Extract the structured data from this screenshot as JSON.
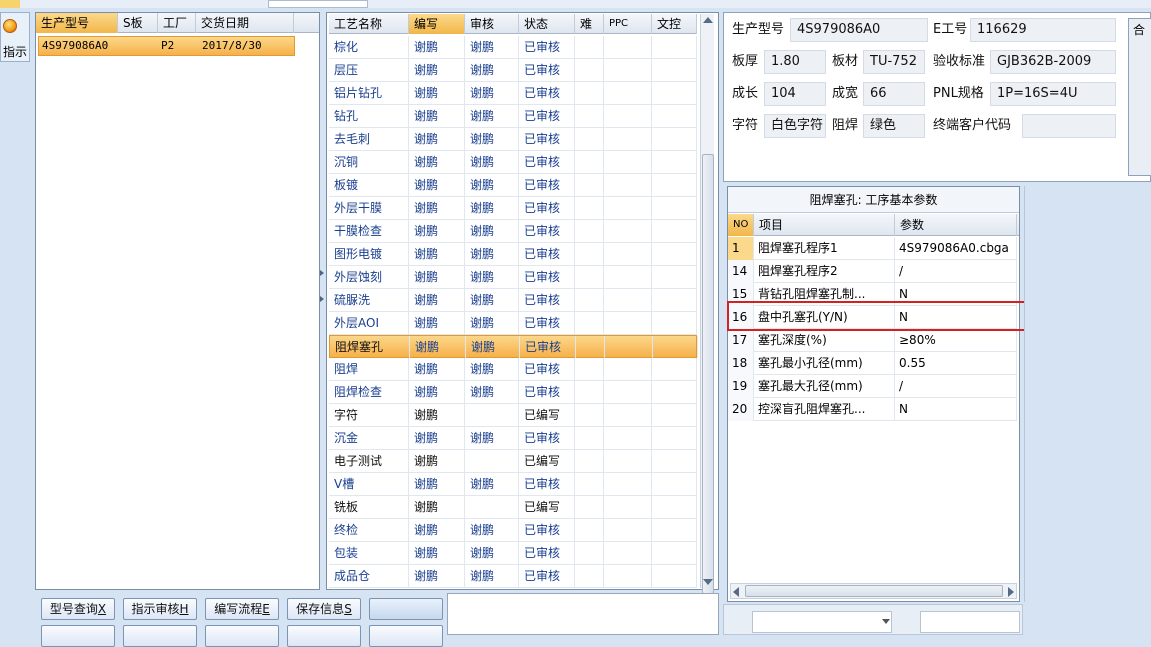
{
  "toolbar": {
    "active_tab": "",
    "guide_label": "指示"
  },
  "product_list": {
    "headers": [
      "生产型号",
      "S板",
      "工厂",
      "交货日期"
    ],
    "row": {
      "model": "4S979086A0",
      "s_board": "",
      "factory": "P2",
      "delivery_date": "2017/8/30"
    }
  },
  "process_grid": {
    "headers": [
      "工艺名称",
      "编写",
      "审核",
      "状态",
      "难",
      "PPC",
      "文控"
    ],
    "rows": [
      {
        "name": "棕化",
        "writer": "谢鹏",
        "reviewer": "谢鹏",
        "status": "已审核"
      },
      {
        "name": "层压",
        "writer": "谢鹏",
        "reviewer": "谢鹏",
        "status": "已审核"
      },
      {
        "name": "铝片钻孔",
        "writer": "谢鹏",
        "reviewer": "谢鹏",
        "status": "已审核"
      },
      {
        "name": "钻孔",
        "writer": "谢鹏",
        "reviewer": "谢鹏",
        "status": "已审核"
      },
      {
        "name": "去毛刺",
        "writer": "谢鹏",
        "reviewer": "谢鹏",
        "status": "已审核"
      },
      {
        "name": "沉铜",
        "writer": "谢鹏",
        "reviewer": "谢鹏",
        "status": "已审核"
      },
      {
        "name": "板镀",
        "writer": "谢鹏",
        "reviewer": "谢鹏",
        "status": "已审核"
      },
      {
        "name": "外层干膜",
        "writer": "谢鹏",
        "reviewer": "谢鹏",
        "status": "已审核"
      },
      {
        "name": "干膜检查",
        "writer": "谢鹏",
        "reviewer": "谢鹏",
        "status": "已审核"
      },
      {
        "name": "图形电镀",
        "writer": "谢鹏",
        "reviewer": "谢鹏",
        "status": "已审核"
      },
      {
        "name": "外层蚀刻",
        "writer": "谢鹏",
        "reviewer": "谢鹏",
        "status": "已审核"
      },
      {
        "name": "硫脲洗",
        "writer": "谢鹏",
        "reviewer": "谢鹏",
        "status": "已审核"
      },
      {
        "name": "外层AOI",
        "writer": "谢鹏",
        "reviewer": "谢鹏",
        "status": "已审核"
      },
      {
        "name": "阻焊塞孔",
        "writer": "谢鹏",
        "reviewer": "谢鹏",
        "status": "已审核"
      },
      {
        "name": "阻焊",
        "writer": "谢鹏",
        "reviewer": "谢鹏",
        "status": "已审核"
      },
      {
        "name": "阻焊检查",
        "writer": "谢鹏",
        "reviewer": "谢鹏",
        "status": "已审核"
      },
      {
        "name": "字符",
        "writer": "谢鹏",
        "reviewer": "",
        "status": "已编写"
      },
      {
        "name": "沉金",
        "writer": "谢鹏",
        "reviewer": "谢鹏",
        "status": "已审核"
      },
      {
        "name": "电子测试",
        "writer": "谢鹏",
        "reviewer": "",
        "status": "已编写"
      },
      {
        "name": "V槽",
        "writer": "谢鹏",
        "reviewer": "谢鹏",
        "status": "已审核"
      },
      {
        "name": "铣板",
        "writer": "谢鹏",
        "reviewer": "",
        "status": "已编写"
      },
      {
        "name": "终检",
        "writer": "谢鹏",
        "reviewer": "谢鹏",
        "status": "已审核"
      },
      {
        "name": "包装",
        "writer": "谢鹏",
        "reviewer": "谢鹏",
        "status": "已审核"
      },
      {
        "name": "成品仓",
        "writer": "谢鹏",
        "reviewer": "谢鹏",
        "status": "已审核"
      }
    ]
  },
  "buttons": [
    {
      "label": "型号查询",
      "key": "X"
    },
    {
      "label": "指示审核",
      "key": "H"
    },
    {
      "label": "编写流程",
      "key": "E"
    },
    {
      "label": "保存信息",
      "key": "S"
    },
    {
      "label": "",
      "key": ""
    }
  ],
  "info": {
    "model_label": "生产型号",
    "model_value": "4S979086A0",
    "e_label": "E工号",
    "e_value": "116629",
    "thickness_label": "板厚",
    "thickness_value": "1.80",
    "material_label": "板材",
    "material_value": "TU-752",
    "standard_label": "验收标准",
    "standard_value": "GJB362B-2009",
    "length_label": "成长",
    "length_value": "104",
    "width_label": "成宽",
    "width_value": "66",
    "pnl_label": "PNL规格",
    "pnl_value": "1P=16S=4U",
    "char_label": "字符",
    "char_value": "白色字符",
    "mask_label": "阻焊",
    "mask_value": "绿色",
    "customer_label": "终端客户代码",
    "customer_value": "",
    "side_tab_label": "合"
  },
  "param_panel": {
    "title": "阻焊塞孔: 工序基本参数",
    "headers": [
      "NO",
      "项目",
      "参数"
    ],
    "rows": [
      {
        "no": "1",
        "item": "阻焊塞孔程序1",
        "value": "4S979086A0.cbga"
      },
      {
        "no": "14",
        "item": "阻焊塞孔程序2",
        "value": "/"
      },
      {
        "no": "15",
        "item": "背钻孔阻焊塞孔制...",
        "value": "N"
      },
      {
        "no": "16",
        "item": "盘中孔塞孔(Y/N)",
        "value": "N"
      },
      {
        "no": "17",
        "item": "塞孔深度(%)",
        "value": "≥80%"
      },
      {
        "no": "18",
        "item": "塞孔最小孔径(mm)",
        "value": "0.55"
      },
      {
        "no": "19",
        "item": "塞孔最大孔径(mm)",
        "value": "/"
      },
      {
        "no": "20",
        "item": "控深盲孔阻焊塞孔...",
        "value": "N"
      }
    ]
  },
  "colors": {
    "accent": "#f6b14a",
    "highlight_border": "#d32020",
    "link_text": "#1a3f8f"
  }
}
